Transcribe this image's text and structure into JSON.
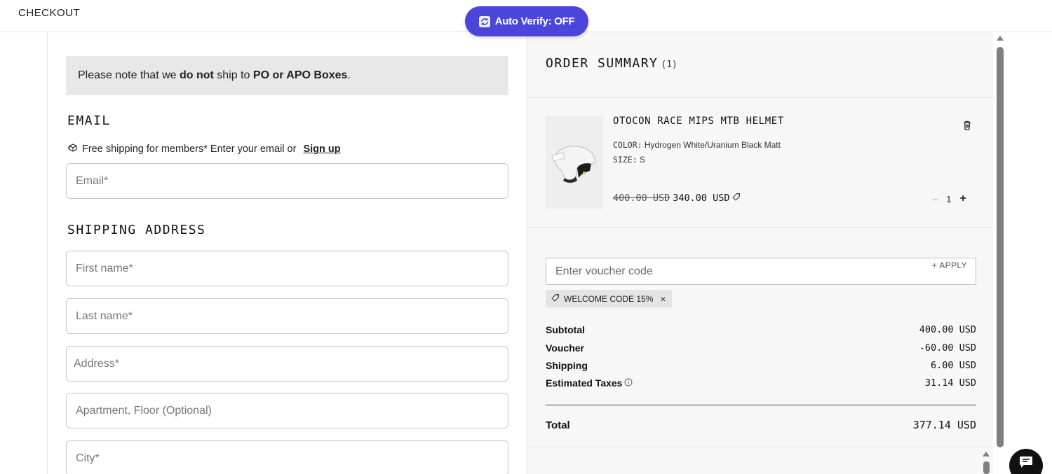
{
  "header": {
    "brand": "CHECKOUT"
  },
  "auto_verify": {
    "label": "Auto Verify: OFF"
  },
  "notice": {
    "prefix": "Please note that we ",
    "emphasis": "do not",
    "middle": " ship to ",
    "boxes": "PO or APO Boxes",
    "suffix": "."
  },
  "email_section": {
    "title": "EMAIL",
    "promo_text": "Free shipping for members* Enter your email or ",
    "signup_link": "Sign up",
    "email_placeholder": "Email*"
  },
  "shipping": {
    "title": "SHIPPING ADDRESS",
    "first_name_placeholder": "First name*",
    "last_name_placeholder": "Last name*",
    "address_placeholder": "Address*",
    "apartment_placeholder": "Apartment, Floor (Optional)",
    "city_placeholder": "City*"
  },
  "summary": {
    "title": "ORDER SUMMARY",
    "count": "(1)",
    "item": {
      "name": "OTOCON RACE MIPS MTB HELMET",
      "color_key": "COLOR:",
      "color_value": "Hydrogen White/Uranium Black Matt",
      "size_key": "SIZE:",
      "size_value": "S",
      "old_price": "400.00 USD",
      "new_price": "340.00",
      "currency": "USD",
      "quantity": "1",
      "minus": "–",
      "plus": "+"
    },
    "voucher_placeholder": "Enter voucher code",
    "apply_label": "+ APPLY",
    "applied_code": "WELCOME CODE 15%",
    "remove_code": "×",
    "lines": {
      "subtotal_label": "Subtotal",
      "subtotal_value": "400.00 USD",
      "voucher_label": "Voucher",
      "voucher_value": "-60.00 USD",
      "shipping_label": "Shipping",
      "shipping_value": "6.00 USD",
      "taxes_label": "Estimated Taxes",
      "taxes_value": "31.14 USD",
      "total_label": "Total",
      "total_value": "377.14 USD"
    }
  },
  "colors": {
    "accent": "#4b46d9",
    "panel": "#f7f7f7",
    "notice_bg": "#e8e8e8"
  },
  "icons": [
    "sync-icon",
    "package-icon",
    "trash-icon",
    "tag-icon",
    "info-icon",
    "chat-icon"
  ]
}
